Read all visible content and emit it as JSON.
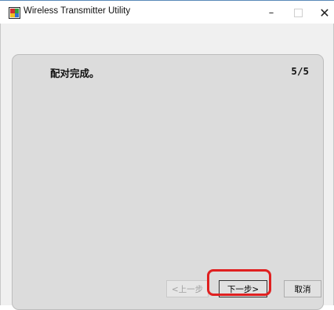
{
  "window": {
    "title": "Wireless Transmitter Utility",
    "minimize_label": "–",
    "close_label": "✕"
  },
  "content": {
    "heading": "配对完成。",
    "step": "5/5"
  },
  "buttons": {
    "prev_label": "<上一步",
    "prev_enabled": false,
    "next_label": "下一步>",
    "cancel_label": "取消"
  },
  "colors": {
    "highlight": "#e02020",
    "panel_background": "#dcdcdc",
    "client_background": "#f0f0f0"
  }
}
